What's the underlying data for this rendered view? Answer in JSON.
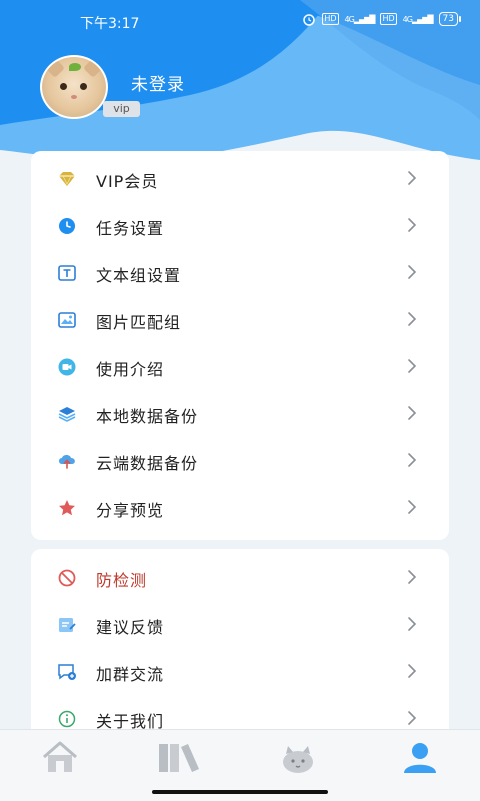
{
  "status_bar": {
    "time": "下午3:17",
    "hd1": "HD",
    "net1": "4G",
    "hd2": "HD",
    "net2": "4G",
    "battery": "73"
  },
  "profile": {
    "username": "未登录",
    "badge": "vip"
  },
  "menu_group_1": [
    {
      "label": "VIP会员",
      "icon": "diamond-icon"
    },
    {
      "label": "任务设置",
      "icon": "clock-icon"
    },
    {
      "label": "文本组设置",
      "icon": "text-box-icon"
    },
    {
      "label": "图片匹配组",
      "icon": "image-icon"
    },
    {
      "label": "使用介绍",
      "icon": "video-icon"
    },
    {
      "label": "本地数据备份",
      "icon": "layers-icon"
    },
    {
      "label": "云端数据备份",
      "icon": "cloud-upload-icon"
    },
    {
      "label": "分享预览",
      "icon": "star-icon"
    }
  ],
  "menu_group_2": [
    {
      "label": "防检测",
      "icon": "ban-icon"
    },
    {
      "label": "建议反馈",
      "icon": "feedback-icon"
    },
    {
      "label": "加群交流",
      "icon": "chat-add-icon"
    },
    {
      "label": "关于我们",
      "icon": "info-icon"
    }
  ],
  "bottom_nav": [
    {
      "name": "home",
      "icon": "home-icon"
    },
    {
      "name": "library",
      "icon": "books-icon"
    },
    {
      "name": "discover",
      "icon": "cat-icon"
    },
    {
      "name": "profile",
      "icon": "user-icon",
      "active": true
    }
  ],
  "colors": {
    "header_light": "#5fb4f7",
    "header_dark": "#1d8ff2",
    "accent": "#3aa0f3",
    "danger": "#c0392b",
    "vip_gold": "#d9b43c",
    "star_red": "#e05a5a"
  }
}
